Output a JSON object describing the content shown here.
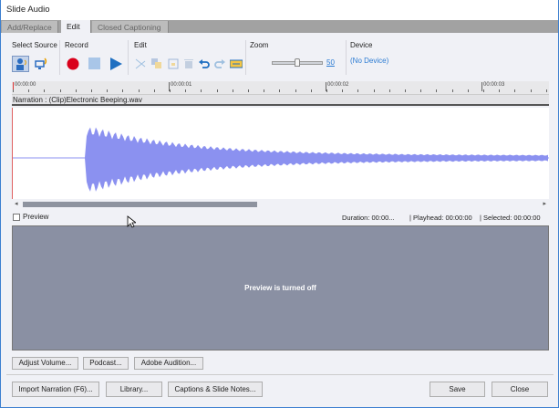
{
  "window": {
    "title": "Slide Audio"
  },
  "tabs": [
    {
      "label": "Add/Replace"
    },
    {
      "label": "Edit"
    },
    {
      "label": "Closed Captioning"
    }
  ],
  "toolbar": {
    "select_source": "Select Source",
    "record": "Record",
    "edit": "Edit",
    "zoom": "Zoom",
    "zoom_value": "50",
    "zoom_fraction": 0.5,
    "device": "Device",
    "device_value": "(No Device)"
  },
  "ruler": [
    "00:00:00",
    "00:00:01",
    "00:00:02",
    "00:00:03"
  ],
  "track": {
    "label": "Narration : (Clip)Electronic Beeping.wav"
  },
  "status": {
    "preview_label": "Preview",
    "duration": "Duration:  00:00...",
    "playhead": "|  Playhead:  00:00:00",
    "selected": "|  Selected:  00:00:00"
  },
  "preview_message": "Preview is turned off",
  "buttons": {
    "adjust_volume": "Adjust Volume...",
    "podcast": "Podcast...",
    "adobe_audition": "Adobe Audition...",
    "import_narration": "Import Narration (F6)...",
    "library": "Library...",
    "captions": "Captions & Slide Notes...",
    "save": "Save",
    "close": "Close"
  },
  "colors": {
    "waveform": "#8b91f0",
    "record": "#d9001b",
    "play": "#1f6fc1",
    "link": "#2b7bd3"
  }
}
